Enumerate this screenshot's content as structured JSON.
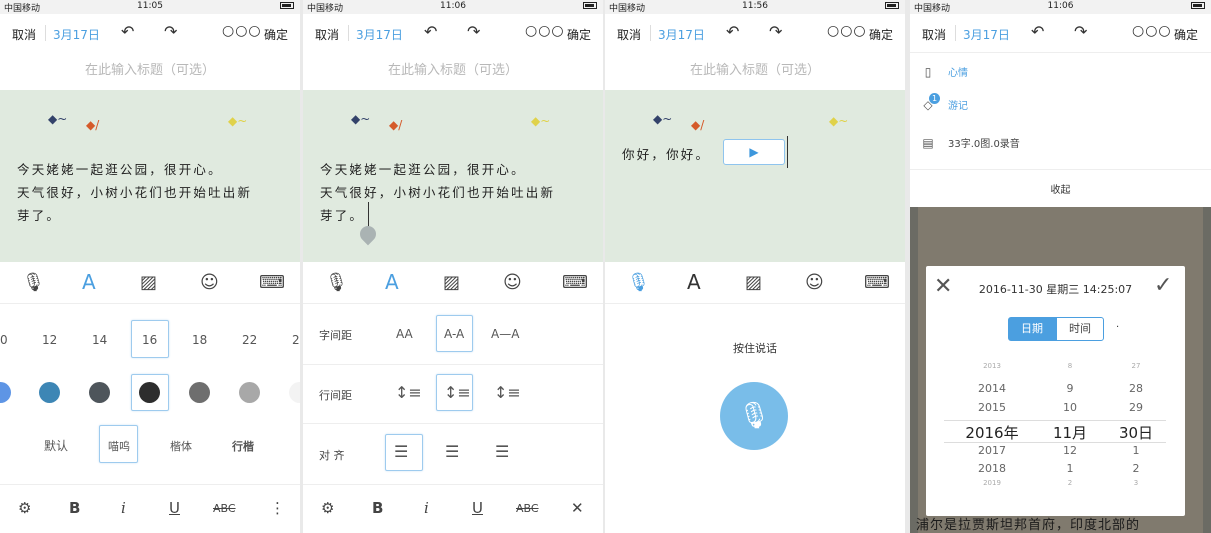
{
  "status": {
    "carrier": "中国移动",
    "times": [
      "11:05",
      "11:06",
      "11:56",
      "11:06"
    ]
  },
  "toolbar": {
    "cancel": "取消",
    "date": "3月17日",
    "undo_icon": "undo-icon",
    "redo_icon": "redo-icon",
    "more": "○○○",
    "confirm": "确定"
  },
  "title_placeholder": "在此输入标题（可选）",
  "body_text": "今天姥姥一起逛公园，很开心。\n天气很好，小树小花们也开始吐出新芽了。",
  "panel3_text": "你好，你好。",
  "font_panel": {
    "sizes": [
      "0",
      "12",
      "14",
      "16",
      "18",
      "22",
      "2"
    ],
    "selected_size": "16",
    "colors": [
      "#5e95e5",
      "#3d86b5",
      "#4e555b",
      "#2d2d2d",
      "#6e6e6e",
      "#a8a8a8",
      "#f3f3f3"
    ],
    "fonts": [
      "默认",
      "喵呜",
      "楷体",
      "行楷"
    ],
    "selected_font": "喵呜"
  },
  "spacing_panel": {
    "letter_spacing_label": "字间距",
    "letter_options": [
      "AA",
      "A-A",
      "A—A"
    ],
    "line_spacing_label": "行间距",
    "align_label": "对 齐"
  },
  "voice": {
    "hold_to_talk": "按住说话"
  },
  "bottom_icons": [
    "gear-icon",
    "B",
    "i",
    "U",
    "ABC",
    "⋮"
  ],
  "panel4": {
    "mood": "心情",
    "travel": "游记",
    "travel_badge": "1",
    "stats": "33字.0图.0录音",
    "collapse": "收起",
    "picker": {
      "datetime": "2016-11-30 星期三 14:25:07",
      "tab_date": "日期",
      "tab_time": "时间",
      "years": [
        "2013",
        "2014",
        "2015",
        "2016年",
        "2017",
        "2018",
        "2019"
      ],
      "months": [
        "8",
        "9",
        "10",
        "11月",
        "12",
        "1",
        "2"
      ],
      "days": [
        "27",
        "28",
        "29",
        "30日",
        "1",
        "2",
        "3"
      ]
    },
    "bg_text": "浦尔是拉贾斯坦邦首府，印度北部的"
  }
}
